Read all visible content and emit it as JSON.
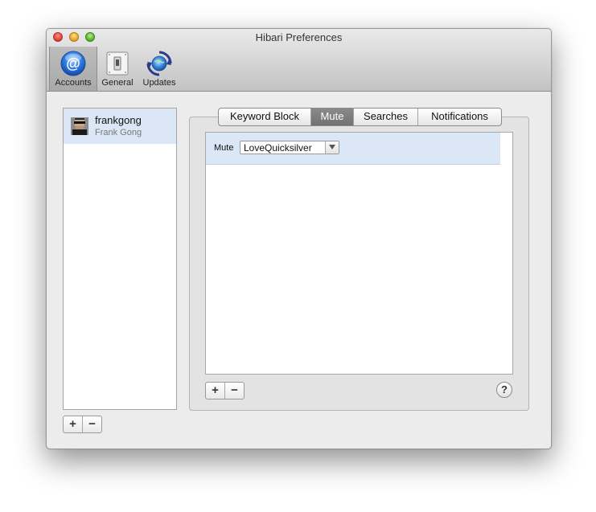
{
  "window": {
    "title": "Hibari Preferences"
  },
  "toolbar": {
    "items": [
      {
        "label": "Accounts",
        "icon": "at-sign-icon",
        "selected": true
      },
      {
        "label": "General",
        "icon": "switch-icon",
        "selected": false
      },
      {
        "label": "Updates",
        "icon": "sync-globe-icon",
        "selected": false
      }
    ]
  },
  "accounts": {
    "items": [
      {
        "username": "frankgong",
        "display_name": "Frank Gong",
        "selected": true
      }
    ],
    "add_label": "+",
    "remove_label": "−"
  },
  "tabs": {
    "items": [
      "Keyword Block",
      "Mute",
      "Searches",
      "Notifications"
    ],
    "active": "Mute"
  },
  "mute": {
    "rows": [
      {
        "label": "Mute",
        "value": "LoveQuicksilver"
      }
    ],
    "add_label": "+",
    "remove_label": "−",
    "help_label": "?"
  },
  "colors": {
    "selection": "#dbe7f6",
    "active_tab": "#7d7d7d",
    "accent": "#2f7be0"
  }
}
